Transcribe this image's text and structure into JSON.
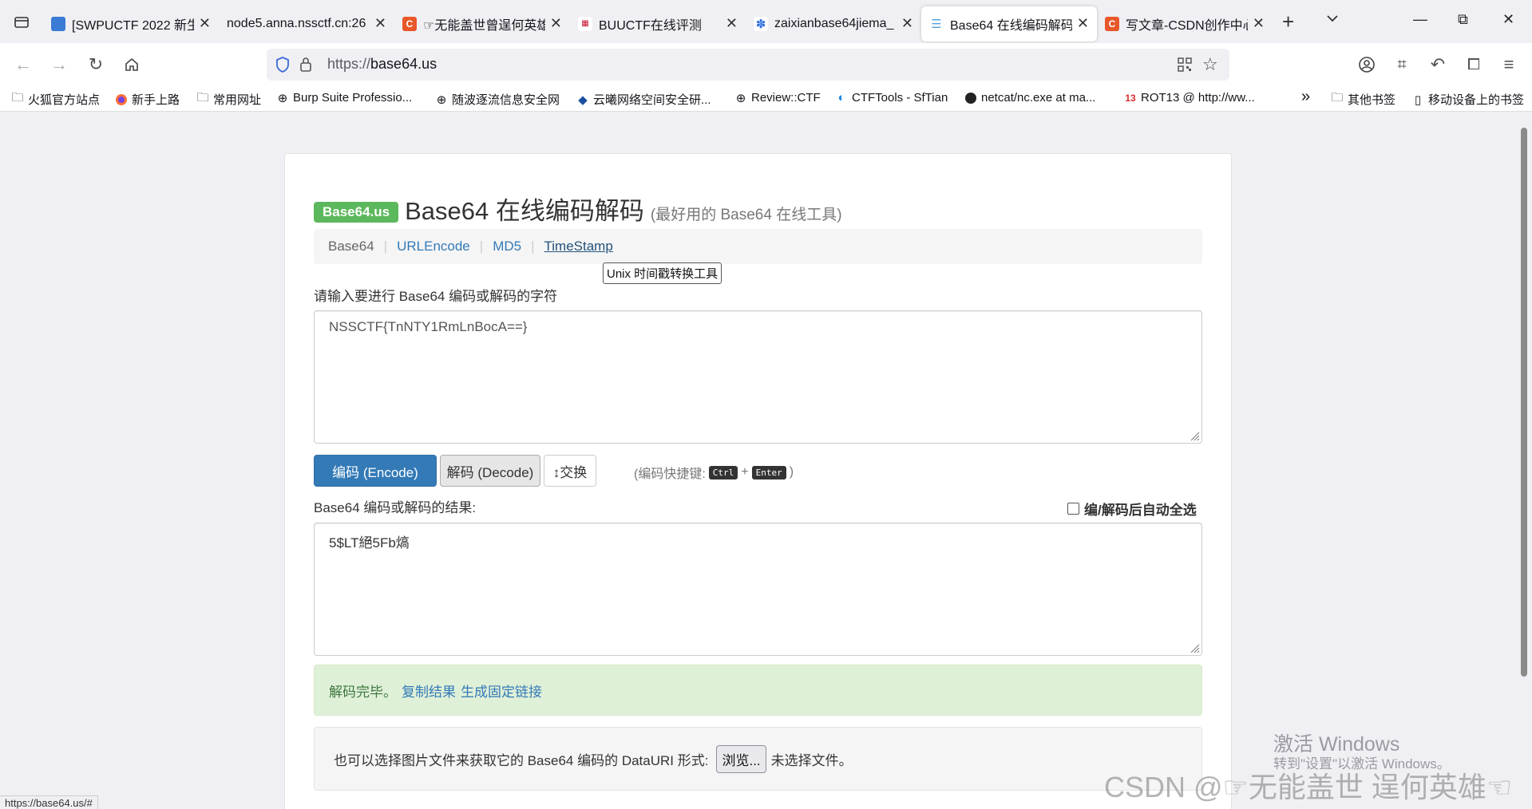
{
  "browser": {
    "tabs": [
      {
        "title": "[SWPUCTF 2022 新生",
        "fav_color": "#3a7bd5",
        "fav_text": ""
      },
      {
        "title": "node5.anna.nssctf.cn:26",
        "fav_color": "",
        "fav_text": ""
      },
      {
        "title": "☞无能盖世曾逞何英雄",
        "fav_color": "#e8572a",
        "fav_text": "C"
      },
      {
        "title": "BUUCTF在线评测",
        "fav_color": "#c8102e",
        "fav_text": ""
      },
      {
        "title": "zaixianbase64jiema_",
        "fav_color": "#2f6fde",
        "fav_text": ""
      },
      {
        "title": "Base64 在线编码解码",
        "fav_color": "#5ba5dc",
        "fav_text": ""
      },
      {
        "title": "写文章-CSDN创作中心",
        "fav_color": "#e8572a",
        "fav_text": "C"
      }
    ],
    "url_proto": "https://",
    "url_host": "base64.us",
    "bookmarks": [
      "火狐官方站点",
      "新手上路",
      "常用网址",
      "Burp Suite Professio...",
      "随波逐流信息安全网",
      "云曦网络空间安全研...",
      "Review::CTF",
      "CTFTools - SfTian",
      "netcat/nc.exe at ma...",
      "ROT13 @ http://ww...",
      "其他书签",
      "移动设备上的书签"
    ],
    "status_url": "https://base64.us/#"
  },
  "page": {
    "brand": "Base64.us",
    "title": "Base64 在线编码解码",
    "subtitle": "(最好用的 Base64 在线工具)",
    "nav": [
      "Base64",
      "URLEncode",
      "MD5",
      "TimeStamp"
    ],
    "tooltip": "Unix 时间戳转换工具",
    "input_label": "请输入要进行 Base64 编码或解码的字符",
    "input_value": "NSSCTF{TnNTY1RmLnBocA==}",
    "encode_label": "编码 (Encode)",
    "decode_label": "解码 (Decode)",
    "swap_label": "↕交换",
    "shortcut_prefix": "(编码快捷键:",
    "shortcut_key1": "Ctrl",
    "shortcut_plus": "+",
    "shortcut_key2": "Enter",
    "shortcut_suffix": ")",
    "output_label": "Base64 编码或解码的结果:",
    "auto_select_label": "编/解码后自动全选",
    "output_value": "5$LT絕5Fb熇",
    "alert_text": "解码完毕。",
    "copy_link": "复制结果",
    "fixed_link": "生成固定链接",
    "file_text": "也可以选择图片文件来获取它的 Base64 编码的 DataURI 形式:",
    "browse_label": "浏览...",
    "no_file": "未选择文件。"
  },
  "overlay": {
    "win_line1": "激活 Windows",
    "win_line2": "转到\"设置\"以激活 Windows。",
    "csdn": "CSDN @☞无能盖世 逞何英雄☜"
  }
}
